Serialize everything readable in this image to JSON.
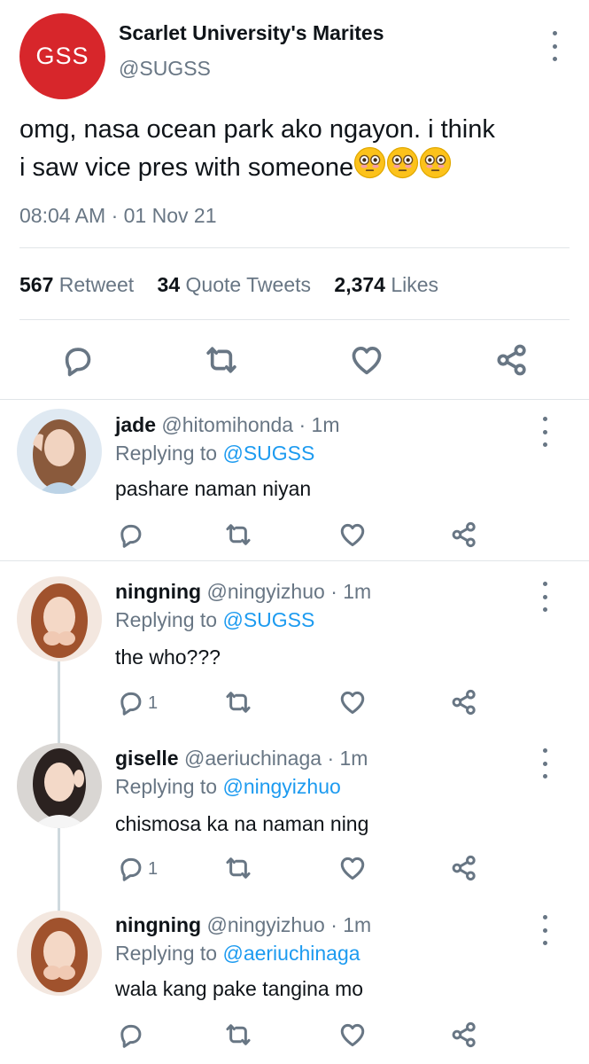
{
  "main": {
    "avatar_text": "GSS",
    "name": "Scarlet University's Marites",
    "handle": "@SUGSS",
    "text_line1": "omg, nasa ocean park ako ngayon. i think",
    "text_line2": "i saw vice pres with someone",
    "emoji": "flushed-face-icon",
    "time": "08:04 AM",
    "date": "01 Nov 21",
    "retweets_count": "567",
    "retweets_label": "Retweet",
    "quotes_count": "34",
    "quotes_label": "Quote Tweets",
    "likes_count": "2,374",
    "likes_label": "Likes"
  },
  "replies": [
    {
      "name": "jade",
      "handle": "@hitomihonda",
      "time": "1m",
      "replying_label": "Replying to",
      "replying_to": "@SUGSS",
      "text": "pashare naman niyan",
      "reply_count": ""
    },
    {
      "name": "ningning",
      "handle": "@ningyizhuo",
      "time": "1m",
      "replying_label": "Replying to",
      "replying_to": "@SUGSS",
      "text": "the who???",
      "reply_count": "1"
    },
    {
      "name": "giselle",
      "handle": "@aeriuchinaga",
      "time": "1m",
      "replying_label": "Replying to",
      "replying_to": "@ningyizhuo",
      "text": "chismosa ka na naman ning",
      "reply_count": "1"
    },
    {
      "name": "ningning",
      "handle": "@ningyizhuo",
      "time": "1m",
      "replying_label": "Replying to",
      "replying_to": "@aeriuchinaga",
      "text": "wala kang pake tangina mo",
      "reply_count": ""
    }
  ],
  "separator": "·",
  "colors": {
    "accent": "#1d9bf0",
    "secondary_text": "#687684",
    "brand_red": "#d7262b",
    "divider": "#e1e5e8"
  }
}
